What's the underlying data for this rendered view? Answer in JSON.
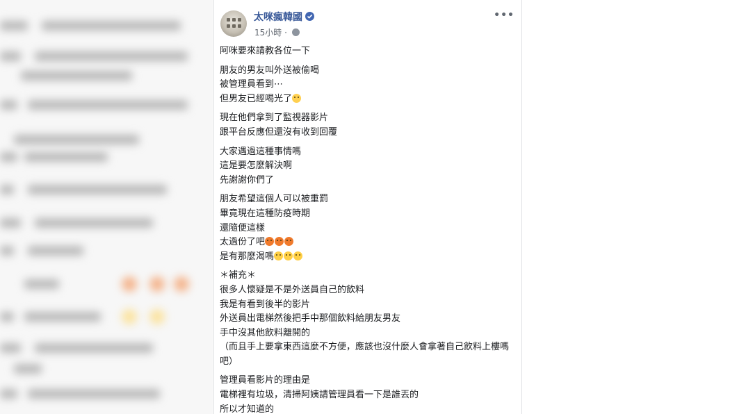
{
  "post": {
    "author": "太咪瘋韓國",
    "timestamp": "15小時",
    "verified_icon": "verified-badge-icon",
    "privacy_icon": "globe-icon",
    "more_icon": "more-options-icon",
    "paragraphs": [
      [
        "阿咪要來請教各位一下"
      ],
      [
        "朋友的男友叫外送被偷喝",
        "被管理員看到⋯",
        "但男友已經喝光了"
      ],
      [
        "現在他們拿到了監視器影片",
        "跟平台反應但還沒有收到回覆"
      ],
      [
        "大家遇過這種事情嗎",
        "這是要怎麼解決啊",
        "先謝謝你們了"
      ],
      [
        "朋友希望這個人可以被重罰",
        "畢竟現在這種防疫時期",
        "還隨便這樣",
        "太過份了吧",
        "是有那麼渴嗎"
      ],
      [
        "＊補充＊",
        "很多人懷疑是不是外送員自己的飲料",
        "我是有看到後半的影片",
        "外送員出電梯然後把手中那個飲料給朋友男友",
        "手中沒其他飲料離開的",
        "（而且手上要拿東西這麼不方便，應該也沒什麼人會拿著自己飲料上樓嗎吧）"
      ],
      [
        "管理員看影片的理由是",
        "電梯裡有垃圾，清掃阿姨請管理員看一下是誰丟的",
        "所以才知道的"
      ]
    ],
    "emojis": {
      "crying": "crying-face-icon",
      "angry": "angry-face-icon",
      "steam": "face-with-steam-icon"
    }
  }
}
